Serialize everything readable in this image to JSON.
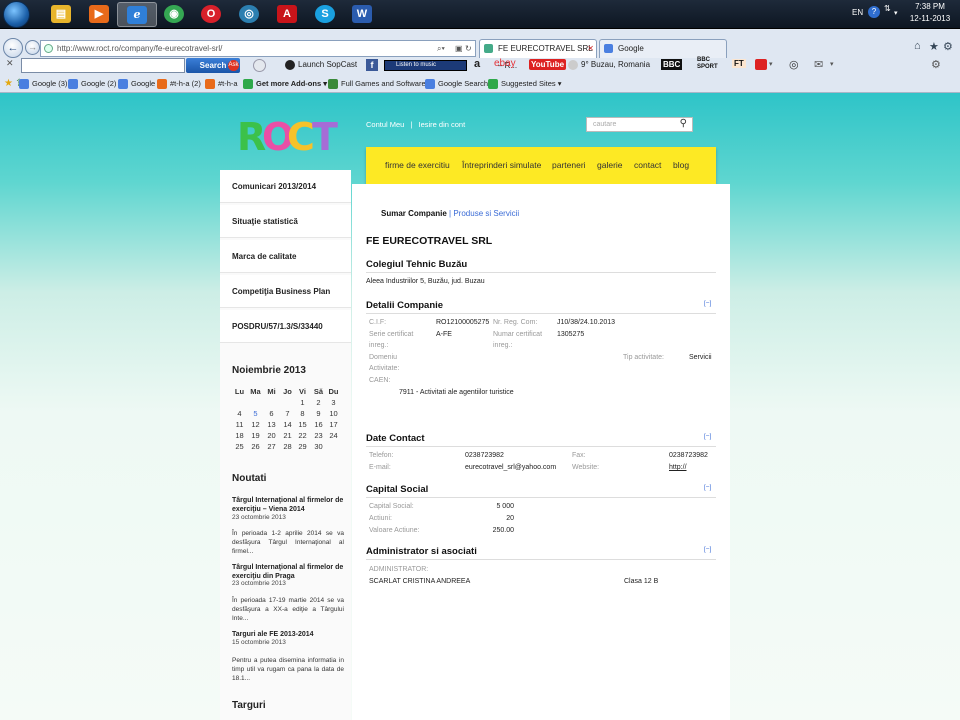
{
  "taskbar": {
    "lang": "EN",
    "time": "7:38 PM",
    "date": "12-11-2013",
    "apps": [
      {
        "name": "start-orb"
      },
      {
        "name": "explorer",
        "color": "#e8b52c",
        "glyph": "▤"
      },
      {
        "name": "media-player",
        "color": "#e86a1a",
        "glyph": "▶"
      },
      {
        "name": "internet-explorer",
        "color": "#2f7fd8",
        "glyph": "e",
        "active": true
      },
      {
        "name": "chrome",
        "color": "#35a853",
        "glyph": "◉"
      },
      {
        "name": "opera",
        "color": "#d8202a",
        "glyph": "O"
      },
      {
        "name": "app-circle",
        "color": "#2c7fb0",
        "glyph": "◎"
      },
      {
        "name": "acrobat",
        "color": "#c8141a",
        "glyph": "A"
      },
      {
        "name": "skype",
        "color": "#1aa0e0",
        "glyph": "S"
      },
      {
        "name": "word",
        "color": "#2b5cae",
        "glyph": "W"
      }
    ]
  },
  "browser": {
    "url": "http://www.roct.ro/company/fe-eurecotravel-srl/",
    "tabs": [
      "FE EURECOTRAVEL SRL – R...",
      "Google"
    ],
    "toolbar": {
      "search_label": "Search",
      "launch_sopcast": "Launch SopCast",
      "listen_music": "Listen to music",
      "ebay": "ebay",
      "youtube": "YouTube",
      "weather": "9° Buzau, Romania",
      "bbc": "BBC",
      "bbc_sport": "BBC SPORT",
      "ft": "FT"
    },
    "favorites": [
      "Google (3)",
      "Google (2)",
      "Google",
      "#t-h-a (2)",
      "#t-h-a",
      "Get more Add-ons ▾",
      "Full Games and Software",
      "Google Search",
      "Suggested Sites ▾"
    ]
  },
  "site": {
    "logo": "ROCT",
    "logo_colors": [
      "#3cc14a",
      "#e94fa6",
      "#f6c22a",
      "#a66cd6"
    ],
    "user_links": {
      "account": "Contul Meu",
      "sep": "|",
      "logout": "Iesire din cont"
    },
    "search_placeholder": "cautare",
    "nav": [
      "firme de exercitiu",
      "Întreprinderi simulate",
      "parteneri",
      "galerie",
      "contact",
      "blog"
    ],
    "sidebar": {
      "items": [
        "Comunicari 2013/2014",
        "Situaţie statistică",
        "Marca de calitate",
        "Competiţia Business Plan",
        "POSDRU/57/1.3/S/33440"
      ],
      "calendar": {
        "title": "Noiembrie 2013",
        "weekdays": [
          "Lu",
          "Ma",
          "Mi",
          "Jo",
          "Vi",
          "Să",
          "Du"
        ],
        "rows": [
          [
            "",
            "",
            "",
            "",
            "1",
            "2",
            "3"
          ],
          [
            "4",
            "5",
            "6",
            "7",
            "8",
            "9",
            "10"
          ],
          [
            "11",
            "12",
            "13",
            "14",
            "15",
            "16",
            "17"
          ],
          [
            "18",
            "19",
            "20",
            "21",
            "22",
            "23",
            "24"
          ],
          [
            "25",
            "26",
            "27",
            "28",
            "29",
            "30",
            ""
          ]
        ],
        "highlight": "5"
      },
      "news_title": "Noutati",
      "news": [
        {
          "title": "Târgul Internaţional al firmelor de exerciţiu – Viena 2014",
          "date": "23 octombrie 2013",
          "body": "În perioada 1-2 aprilie 2014 se va desfăşura Târgul Internaţional al firmel..."
        },
        {
          "title": "Târgul Internaţional al firmelor de exerciţiu din Praga",
          "date": "23 octombrie 2013",
          "body": "În perioada 17-19 martie 2014 se va desfăşura a XX-a ediţie a Târgului Inte..."
        },
        {
          "title": "Targuri ale FE 2013-2014",
          "date": "15 octombrie 2013",
          "body": "Pentru a putea disemina informatia in timp util va rugam ca pana la data de 18.1..."
        }
      ],
      "targuri_title": "Targuri"
    },
    "content": {
      "subnav_active": "Sumar Companie",
      "subnav_sep": "|",
      "subnav_link": "Produse si Servicii",
      "company_name": "FE EURECOTRAVEL SRL",
      "school_name": "Colegiul Tehnic Buzău",
      "address": "Aleea Industriilor 5, Buzău, jud. Buzau",
      "collapse_label": "[−]",
      "details": {
        "title": "Detalii Companie",
        "cif_label": "C.I.F:",
        "cif": "RO12100005275",
        "reg_label": "Nr. Reg. Com:",
        "reg": "J10/38/24.10.2013",
        "serie_label_1": "Serie certificat",
        "serie_label_2": "inreg.:",
        "serie": "A-FE",
        "numar_label_1": "Numar certificat",
        "numar_label_2": "inreg.:",
        "numar": "1305275",
        "domeniu_label_1": "Domeniu",
        "domeniu_label_2": "Activitate:",
        "tip_label": "Tip activitate:",
        "tip": "Servicii",
        "caen_label": "CAEN:",
        "caen": "7911 - Activitati ale agentiilor turistice"
      },
      "contact": {
        "title": "Date Contact",
        "tel_label": "Telefon:",
        "tel": "0238723982",
        "fax_label": "Fax:",
        "fax": "0238723982",
        "email_label": "E-mail:",
        "email": "eurecotravel_srl@yahoo.com",
        "web_label": "Website:",
        "web": "http://"
      },
      "capital": {
        "title": "Capital Social",
        "social_label": "Capital Social:",
        "social": "5 000",
        "actiuni_label": "Actiuni:",
        "actiuni": "20",
        "valoare_label": "Valoare Actiune:",
        "valoare": "250.00"
      },
      "admin": {
        "title": "Administrator si asociati",
        "role_label": "ADMINISTRATOR:",
        "person": "SCARLAT CRISTINA ANDREEA",
        "class": "Clasa 12 B"
      }
    }
  }
}
